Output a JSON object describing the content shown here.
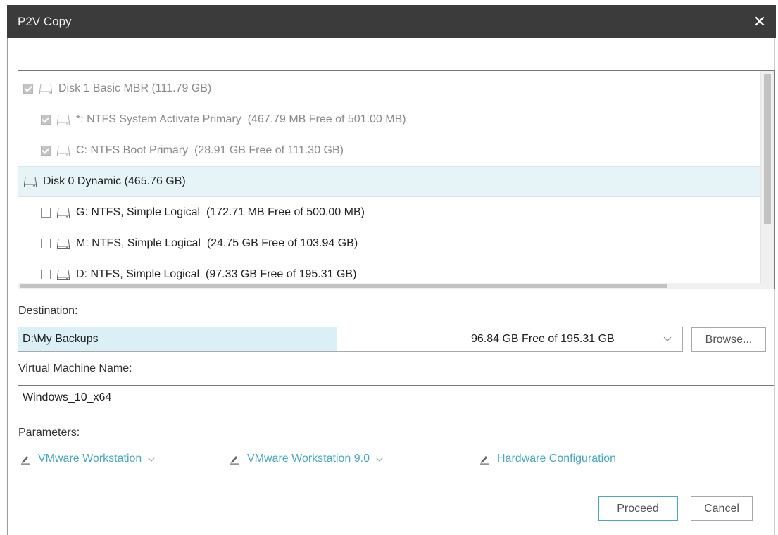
{
  "window": {
    "title": "P2V Copy"
  },
  "tree": {
    "rows": [
      {
        "label": "Disk 1 Basic MBR (111.79 GB)",
        "checked": true,
        "disabled": true,
        "level": 0,
        "icon": "disk-icon"
      },
      {
        "label": "*: NTFS System Activate Primary  (467.79 MB Free of 501.00 MB)",
        "checked": true,
        "disabled": true,
        "level": 1,
        "icon": "disk-icon"
      },
      {
        "label": "C: NTFS Boot Primary  (28.91 GB Free of 111.30 GB)",
        "checked": true,
        "disabled": true,
        "level": 1,
        "icon": "disk-icon"
      },
      {
        "label": "Disk 0 Dynamic (465.76 GB)",
        "checked": false,
        "disabled": false,
        "level": 0,
        "icon": "disk-icon",
        "highlighted": true
      },
      {
        "label": "G: NTFS, Simple Logical  (172.71 MB Free of 500.00 MB)",
        "checked": false,
        "disabled": false,
        "level": 1,
        "icon": "disk-icon"
      },
      {
        "label": "M: NTFS, Simple Logical  (24.75 GB Free of 103.94 GB)",
        "checked": false,
        "disabled": false,
        "level": 1,
        "icon": "disk-icon"
      },
      {
        "label": "D: NTFS, Simple Logical  (97.33 GB Free of 195.31 GB)",
        "checked": false,
        "disabled": false,
        "level": 1,
        "icon": "disk-icon"
      }
    ]
  },
  "destination": {
    "label": "Destination:",
    "path": "D:\\My Backups",
    "free_text": "96.84 GB Free of 195.31 GB",
    "used_fraction": 0.48,
    "browse_label": "Browse..."
  },
  "vm_name": {
    "label": "Virtual Machine Name:",
    "value": "Windows_10_x64"
  },
  "parameters": {
    "label": "Parameters:",
    "product": "VMware Workstation",
    "version": "VMware Workstation 9.0",
    "hardware": "Hardware Configuration"
  },
  "footer": {
    "proceed_label": "Proceed",
    "cancel_label": "Cancel"
  },
  "colors": {
    "titlebar": "#3b3b3b",
    "link": "#4aa7c0",
    "highlight": "#e6f3f7",
    "accent_border": "#4aa7c0"
  }
}
